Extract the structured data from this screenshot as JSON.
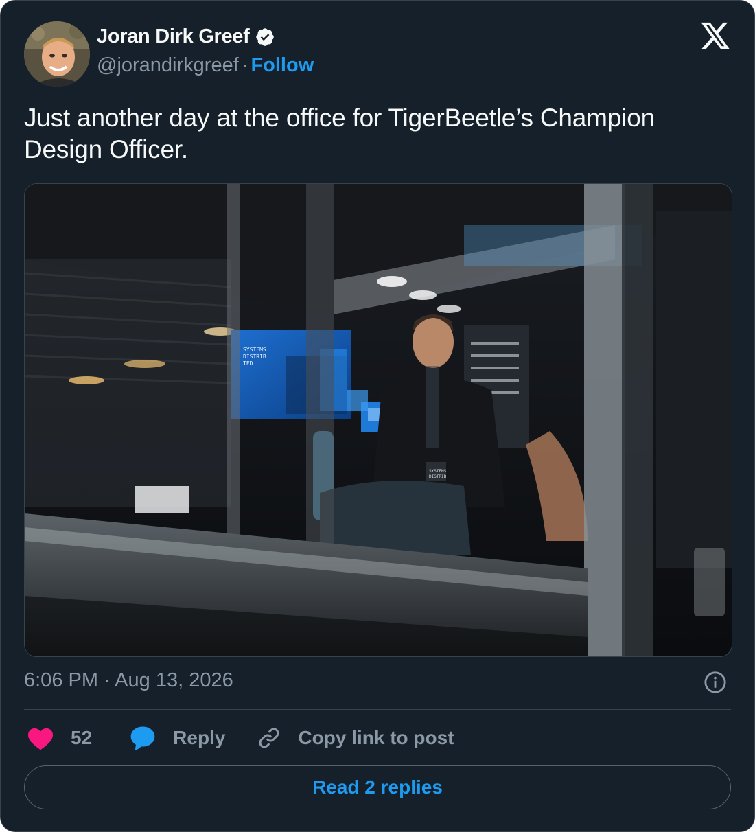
{
  "author": {
    "display_name": "Joran Dirk Greef",
    "handle": "@jorandirkgreef",
    "separator": "·",
    "follow_label": "Follow",
    "verified": true
  },
  "brand": {
    "logo": "x-logo-icon"
  },
  "tweet": {
    "text": "Just another day at the office for TigerBeetle’s Champion Design Officer.",
    "media": {
      "kind": "photo",
      "screen_text": [
        "SYSTEMS",
        "DISTRIB",
        "TED"
      ],
      "badge_text": [
        "SYSTEMS",
        "DISTRIB"
      ]
    },
    "timestamp": "6:06 PM · Aug 13, 2026"
  },
  "actions": {
    "like_count": "52",
    "reply_label": "Reply",
    "copy_link_label": "Copy link to post"
  },
  "read_replies_label": "Read 2 replies",
  "colors": {
    "background": "#15202b",
    "text": "#f7f9f9",
    "muted": "#8b98a5",
    "accent": "#1d9bf0",
    "like": "#f91880",
    "border": "#38444d"
  },
  "icons": [
    "verified-icon",
    "x-logo-icon",
    "info-icon",
    "heart-icon",
    "reply-bubble-icon",
    "link-icon"
  ]
}
